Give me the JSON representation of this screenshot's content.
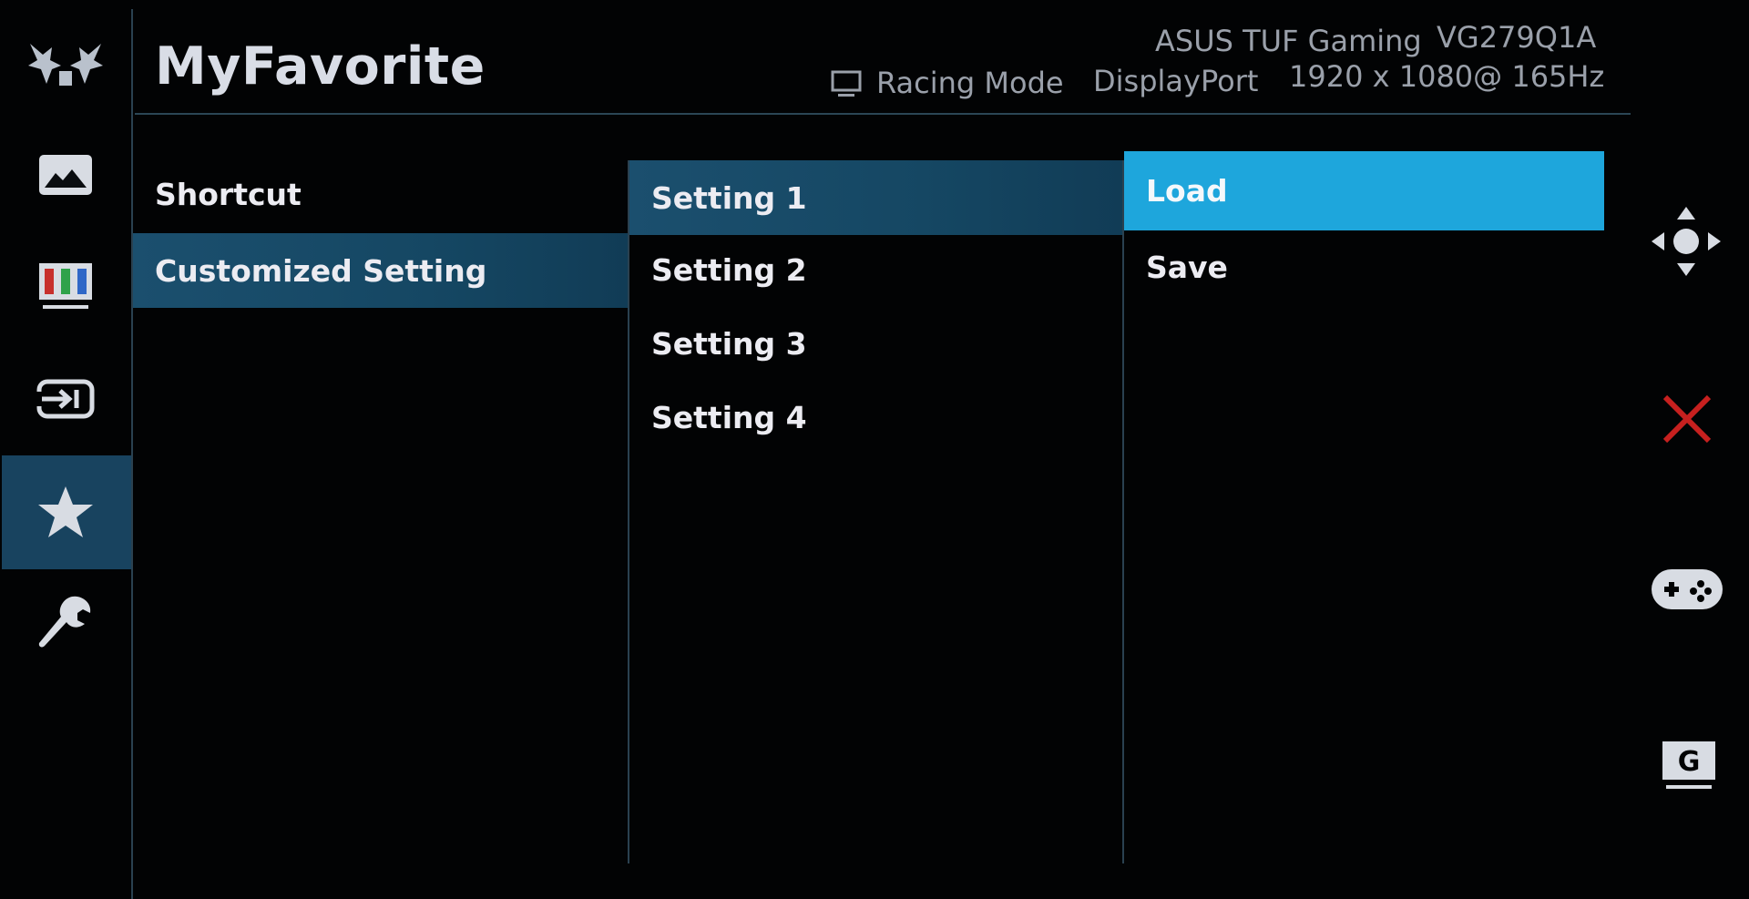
{
  "header": {
    "title": "MyFavorite",
    "brand": "ASUS TUF Gaming",
    "model": "VG279Q1A",
    "mode": "Racing Mode",
    "input": "DisplayPort",
    "resolution": "1920 x 1080@ 165Hz"
  },
  "rail": {
    "items": [
      {
        "icon": "tuf-logo-icon"
      },
      {
        "icon": "image-icon"
      },
      {
        "icon": "color-bars-icon"
      },
      {
        "icon": "input-select-icon"
      },
      {
        "icon": "star-icon",
        "selected": true
      },
      {
        "icon": "wrench-icon"
      }
    ]
  },
  "menu": {
    "level1": [
      "Shortcut",
      "Customized Setting"
    ],
    "level1_selected": "Customized Setting",
    "level2": [
      "Setting 1",
      "Setting 2",
      "Setting 3",
      "Setting 4"
    ],
    "level2_selected": "Setting 1",
    "level3": [
      "Load",
      "Save"
    ],
    "level3_selected": "Load"
  },
  "hints": [
    {
      "icon": "five-way-navigation-icon"
    },
    {
      "icon": "close-icon"
    },
    {
      "icon": "gamepad-icon"
    },
    {
      "icon": "gameplus-g-icon"
    }
  ],
  "colors": {
    "background": "#020304",
    "selected_dark": "#18435f",
    "selected_bright": "#1ea6dc",
    "close_red": "#c7201f"
  }
}
